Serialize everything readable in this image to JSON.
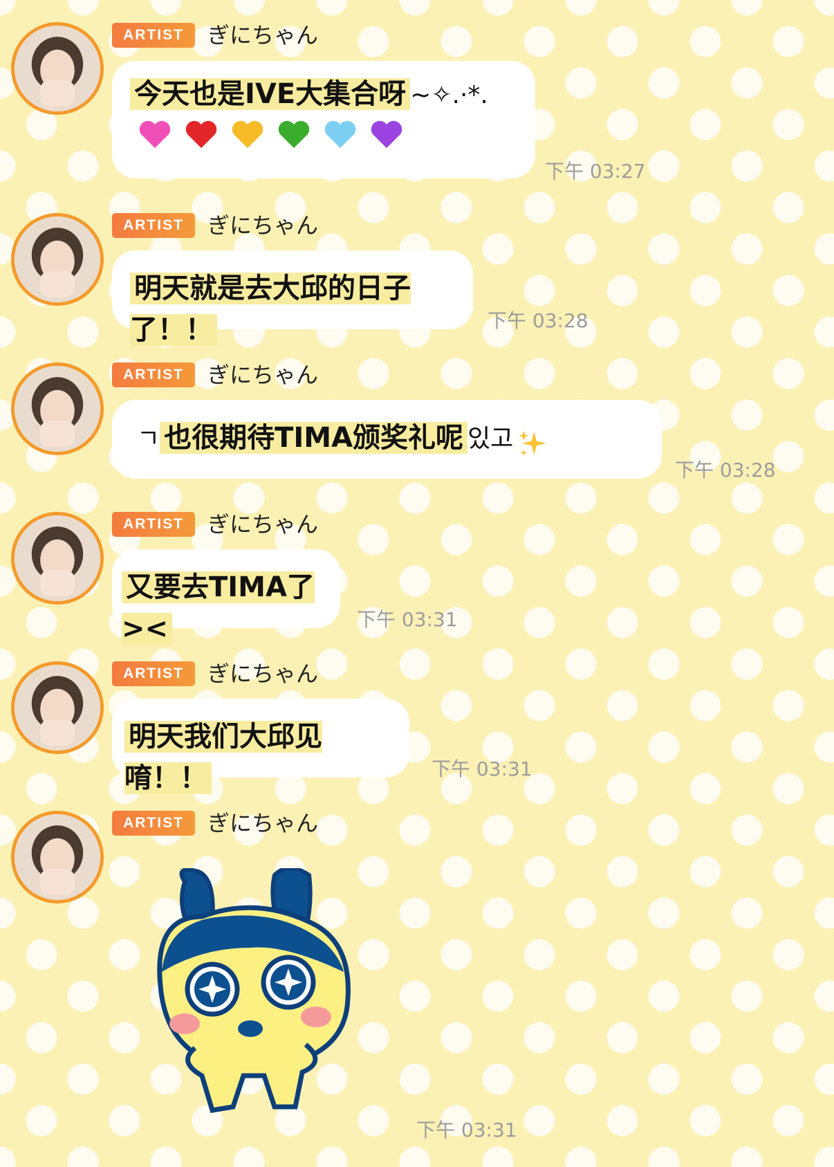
{
  "messages": [
    {
      "badge": "ARTIST",
      "sender": "ぎにちゃん",
      "text": "今天也是IVE大集合呀",
      "suffix": "~✧.·*.",
      "time": "下午 03:27",
      "hearts": [
        "pink-heart-icon",
        "red-heart-icon",
        "yellow-heart-icon",
        "green-heart-icon",
        "blue-heart-icon",
        "purple-heart-icon"
      ]
    },
    {
      "badge": "ARTIST",
      "sender": "ぎにちゃん",
      "text": "明天就是去大邱的日子了！！",
      "time": "下午 03:28"
    },
    {
      "badge": "ARTIST",
      "sender": "ぎにちゃん",
      "prefix": "ㄱ",
      "text": "也很期待TIMA颁奖礼呢",
      "suffix": "있고",
      "time": "下午 03:28"
    },
    {
      "badge": "ARTIST",
      "sender": "ぎにちゃん",
      "text": "又要去TIMA了><",
      "time": "下午 03:31"
    },
    {
      "badge": "ARTIST",
      "sender": "ぎにちゃん",
      "text": "明天我们大邱见唷！！",
      "time": "下午 03:31"
    },
    {
      "badge": "ARTIST",
      "sender": "ぎにちゃん",
      "sticker": "tamagotchi-sticker",
      "time": "下午 03:31"
    }
  ],
  "colors": {
    "background": "#fbf1b5",
    "badge": "#f47b3f",
    "avatar_ring": "#f49a2b",
    "highlight": "#f8eca0",
    "time": "#9c9c9c"
  }
}
